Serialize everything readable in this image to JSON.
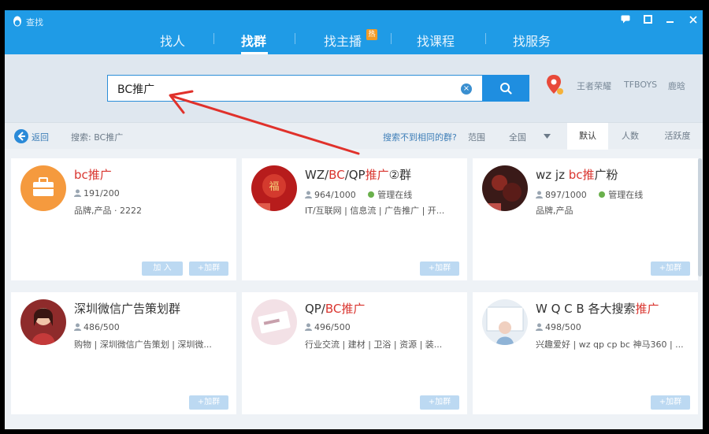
{
  "app": {
    "title": "查找"
  },
  "nav": {
    "tabs": [
      {
        "label": "找人"
      },
      {
        "label": "找群"
      },
      {
        "label": "找主播"
      },
      {
        "label": "找课程"
      },
      {
        "label": "找服务"
      }
    ],
    "hot_badge": "热"
  },
  "search": {
    "value": "BC推广",
    "clear_label": "×"
  },
  "hot_words": [
    "王者荣耀",
    "TFBOYS",
    "鹿晗"
  ],
  "toolbar": {
    "back_label": "返回",
    "query_label": "搜索: BC推广",
    "not_found_link": "搜索不到相同的群?",
    "scope_label": "范围",
    "scope_value": "全国",
    "sort_tabs": [
      "默认",
      "人数",
      "活跃度"
    ]
  },
  "cards": [
    {
      "name_parts": [
        "bc推广"
      ],
      "members": "191/200",
      "admin_online": "",
      "tags": "品牌,产品 · 2222",
      "buttons": [
        "加 入",
        "+加群"
      ]
    },
    {
      "name_parts": [
        "WZ/",
        "BC",
        "/QP",
        "推广",
        "②群"
      ],
      "members": "964/1000",
      "admin_online": "管理在线",
      "tags": "IT/互联网 | 信息流 | 广告推广 | 开...",
      "buttons": [
        "+加群"
      ]
    },
    {
      "name_parts": [
        "wz jz ",
        "bc推",
        "广粉"
      ],
      "members": "897/1000",
      "admin_online": "管理在线",
      "tags": "品牌,产品",
      "buttons": [
        "+加群"
      ]
    },
    {
      "name_parts": [
        "深圳微信广告策划群"
      ],
      "members": "486/500",
      "admin_online": "",
      "tags": "购物 | 深圳微信广告策划 | 深圳微...",
      "buttons": [
        "+加群"
      ]
    },
    {
      "name_parts": [
        "QP/",
        "BC推广"
      ],
      "members": "496/500",
      "admin_online": "",
      "tags": "行业交流 | 建材 | 卫浴 | 资源 | 装...",
      "buttons": [
        "+加群"
      ]
    },
    {
      "name_parts": [
        "W Q C B 各大搜索",
        "推广"
      ],
      "members": "498/500",
      "admin_online": "",
      "tags": "兴趣爱好 | wz qp cp bc 神马360 | ...",
      "buttons": [
        "+加群"
      ]
    }
  ],
  "colors": {
    "brand_blue": "#1f9be6",
    "highlight_red": "#d9352f",
    "annotation_red": "#e0312b",
    "online_green": "#6ab04c"
  },
  "icons": [
    "qq-penguin-icon",
    "search-icon",
    "location-pin-icon",
    "back-arrow-icon",
    "user-icon",
    "chevron-down-icon",
    "minimize-icon",
    "maximize-icon",
    "close-icon",
    "chat-icon"
  ]
}
